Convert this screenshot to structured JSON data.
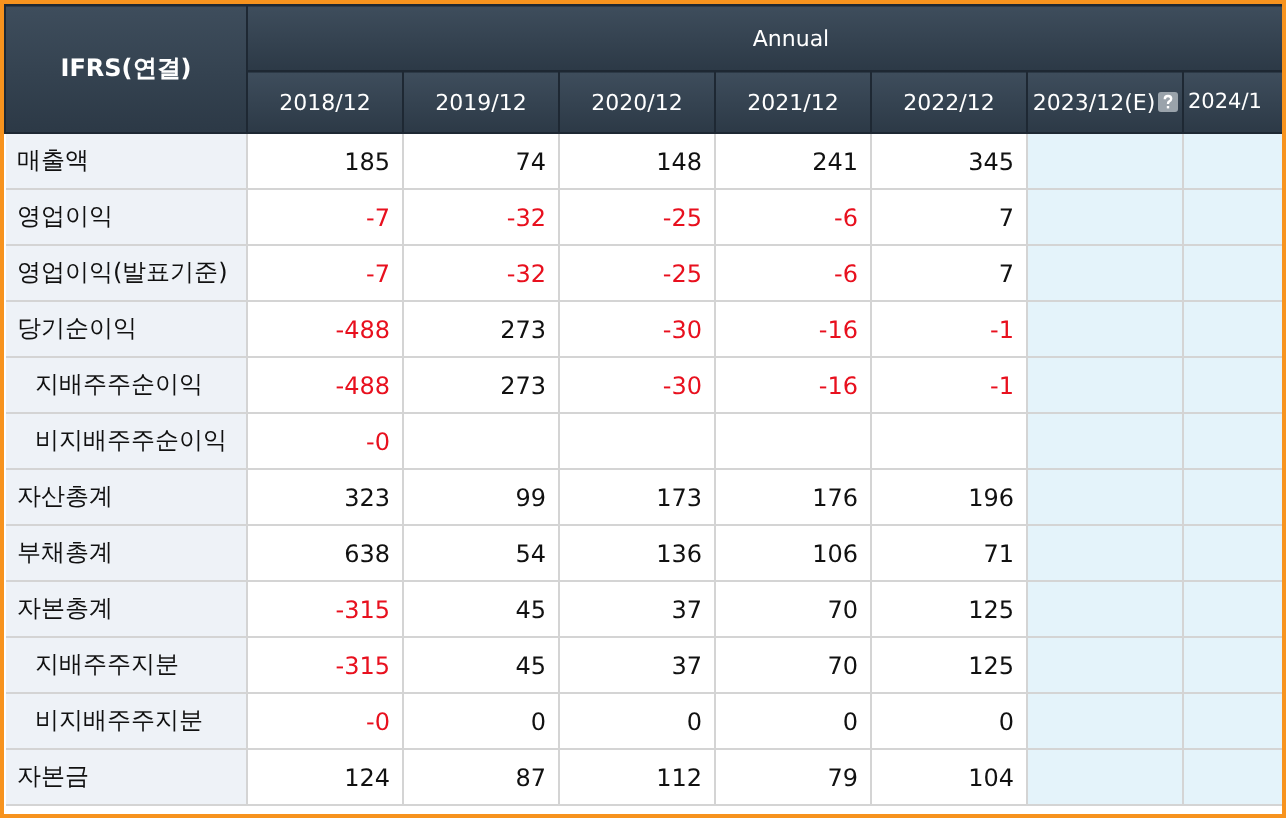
{
  "table": {
    "corner": "IFRS(연결)",
    "group": "Annual",
    "columns": [
      {
        "label": "2018/12",
        "estimate": false,
        "info": false
      },
      {
        "label": "2019/12",
        "estimate": false,
        "info": false
      },
      {
        "label": "2020/12",
        "estimate": false,
        "info": false
      },
      {
        "label": "2021/12",
        "estimate": false,
        "info": false
      },
      {
        "label": "2022/12",
        "estimate": false,
        "info": false
      },
      {
        "label": "2023/12(E)",
        "estimate": true,
        "info": true
      },
      {
        "label": "2024/1",
        "estimate": true,
        "info": false
      }
    ],
    "rows": [
      {
        "label": "매출액",
        "cells": [
          {
            "text": "185",
            "negative": false
          },
          {
            "text": "74",
            "negative": false
          },
          {
            "text": "148",
            "negative": false
          },
          {
            "text": "241",
            "negative": false
          },
          {
            "text": "345",
            "negative": false
          },
          null,
          null
        ]
      },
      {
        "label": "영업이익",
        "cells": [
          {
            "text": "-7",
            "negative": true
          },
          {
            "text": "-32",
            "negative": true
          },
          {
            "text": "-25",
            "negative": true
          },
          {
            "text": "-6",
            "negative": true
          },
          {
            "text": "7",
            "negative": false
          },
          null,
          null
        ]
      },
      {
        "label": "영업이익(발표기준)",
        "cells": [
          {
            "text": "-7",
            "negative": true
          },
          {
            "text": "-32",
            "negative": true
          },
          {
            "text": "-25",
            "negative": true
          },
          {
            "text": "-6",
            "negative": true
          },
          {
            "text": "7",
            "negative": false
          },
          null,
          null
        ]
      },
      {
        "label": "당기순이익",
        "cells": [
          {
            "text": "-488",
            "negative": true
          },
          {
            "text": "273",
            "negative": false
          },
          {
            "text": "-30",
            "negative": true
          },
          {
            "text": "-16",
            "negative": true
          },
          {
            "text": "-1",
            "negative": true
          },
          null,
          null
        ],
        "children": [
          {
            "label": "지배주주순이익",
            "cells": [
              {
                "text": "-488",
                "negative": true
              },
              {
                "text": "273",
                "negative": false
              },
              {
                "text": "-30",
                "negative": true
              },
              {
                "text": "-16",
                "negative": true
              },
              {
                "text": "-1",
                "negative": true
              },
              null,
              null
            ]
          },
          {
            "label": "비지배주주순이익",
            "cells": [
              {
                "text": "-0",
                "negative": true
              },
              null,
              null,
              null,
              null,
              null,
              null
            ]
          }
        ]
      },
      {
        "label": "자산총계",
        "cells": [
          {
            "text": "323",
            "negative": false
          },
          {
            "text": "99",
            "negative": false
          },
          {
            "text": "173",
            "negative": false
          },
          {
            "text": "176",
            "negative": false
          },
          {
            "text": "196",
            "negative": false
          },
          null,
          null
        ]
      },
      {
        "label": "부채총계",
        "cells": [
          {
            "text": "638",
            "negative": false
          },
          {
            "text": "54",
            "negative": false
          },
          {
            "text": "136",
            "negative": false
          },
          {
            "text": "106",
            "negative": false
          },
          {
            "text": "71",
            "negative": false
          },
          null,
          null
        ]
      },
      {
        "label": "자본총계",
        "cells": [
          {
            "text": "-315",
            "negative": true
          },
          {
            "text": "45",
            "negative": false
          },
          {
            "text": "37",
            "negative": false
          },
          {
            "text": "70",
            "negative": false
          },
          {
            "text": "125",
            "negative": false
          },
          null,
          null
        ],
        "children": [
          {
            "label": "지배주주지분",
            "cells": [
              {
                "text": "-315",
                "negative": true
              },
              {
                "text": "45",
                "negative": false
              },
              {
                "text": "37",
                "negative": false
              },
              {
                "text": "70",
                "negative": false
              },
              {
                "text": "125",
                "negative": false
              },
              null,
              null
            ]
          },
          {
            "label": "비지배주주지분",
            "cells": [
              {
                "text": "-0",
                "negative": true
              },
              {
                "text": "0",
                "negative": false
              },
              {
                "text": "0",
                "negative": false
              },
              {
                "text": "0",
                "negative": false
              },
              {
                "text": "0",
                "negative": false
              },
              null,
              null
            ]
          }
        ]
      },
      {
        "label": "자본금",
        "cells": [
          {
            "text": "124",
            "negative": false
          },
          {
            "text": "87",
            "negative": false
          },
          {
            "text": "112",
            "negative": false
          },
          {
            "text": "79",
            "negative": false
          },
          {
            "text": "104",
            "negative": false
          },
          null,
          null
        ]
      }
    ]
  }
}
